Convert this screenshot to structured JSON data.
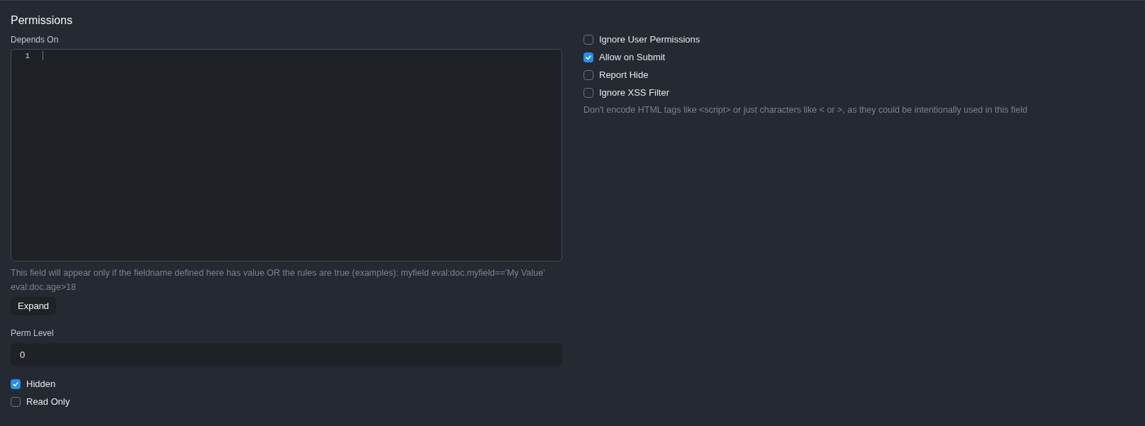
{
  "section": {
    "title": "Permissions"
  },
  "depends_on": {
    "label": "Depends On",
    "line_numbers": [
      "1"
    ],
    "help": "This field will appear only if the fieldname defined here has value OR the rules are true (examples): myfield eval:doc.myfield=='My Value' eval:doc.age>18",
    "expand_button": "Expand"
  },
  "perm_level": {
    "label": "Perm Level",
    "value": "0"
  },
  "left_checks": [
    {
      "label": "Hidden",
      "checked": true
    },
    {
      "label": "Read Only",
      "checked": false
    }
  ],
  "right_checks": [
    {
      "label": "Ignore User Permissions",
      "checked": false
    },
    {
      "label": "Allow on Submit",
      "checked": true
    },
    {
      "label": "Report Hide",
      "checked": false
    },
    {
      "label": "Ignore XSS Filter",
      "checked": false
    }
  ],
  "right_help": "Don't encode HTML tags like <script> or just characters like < or >, as they could be intentionally used in this field"
}
